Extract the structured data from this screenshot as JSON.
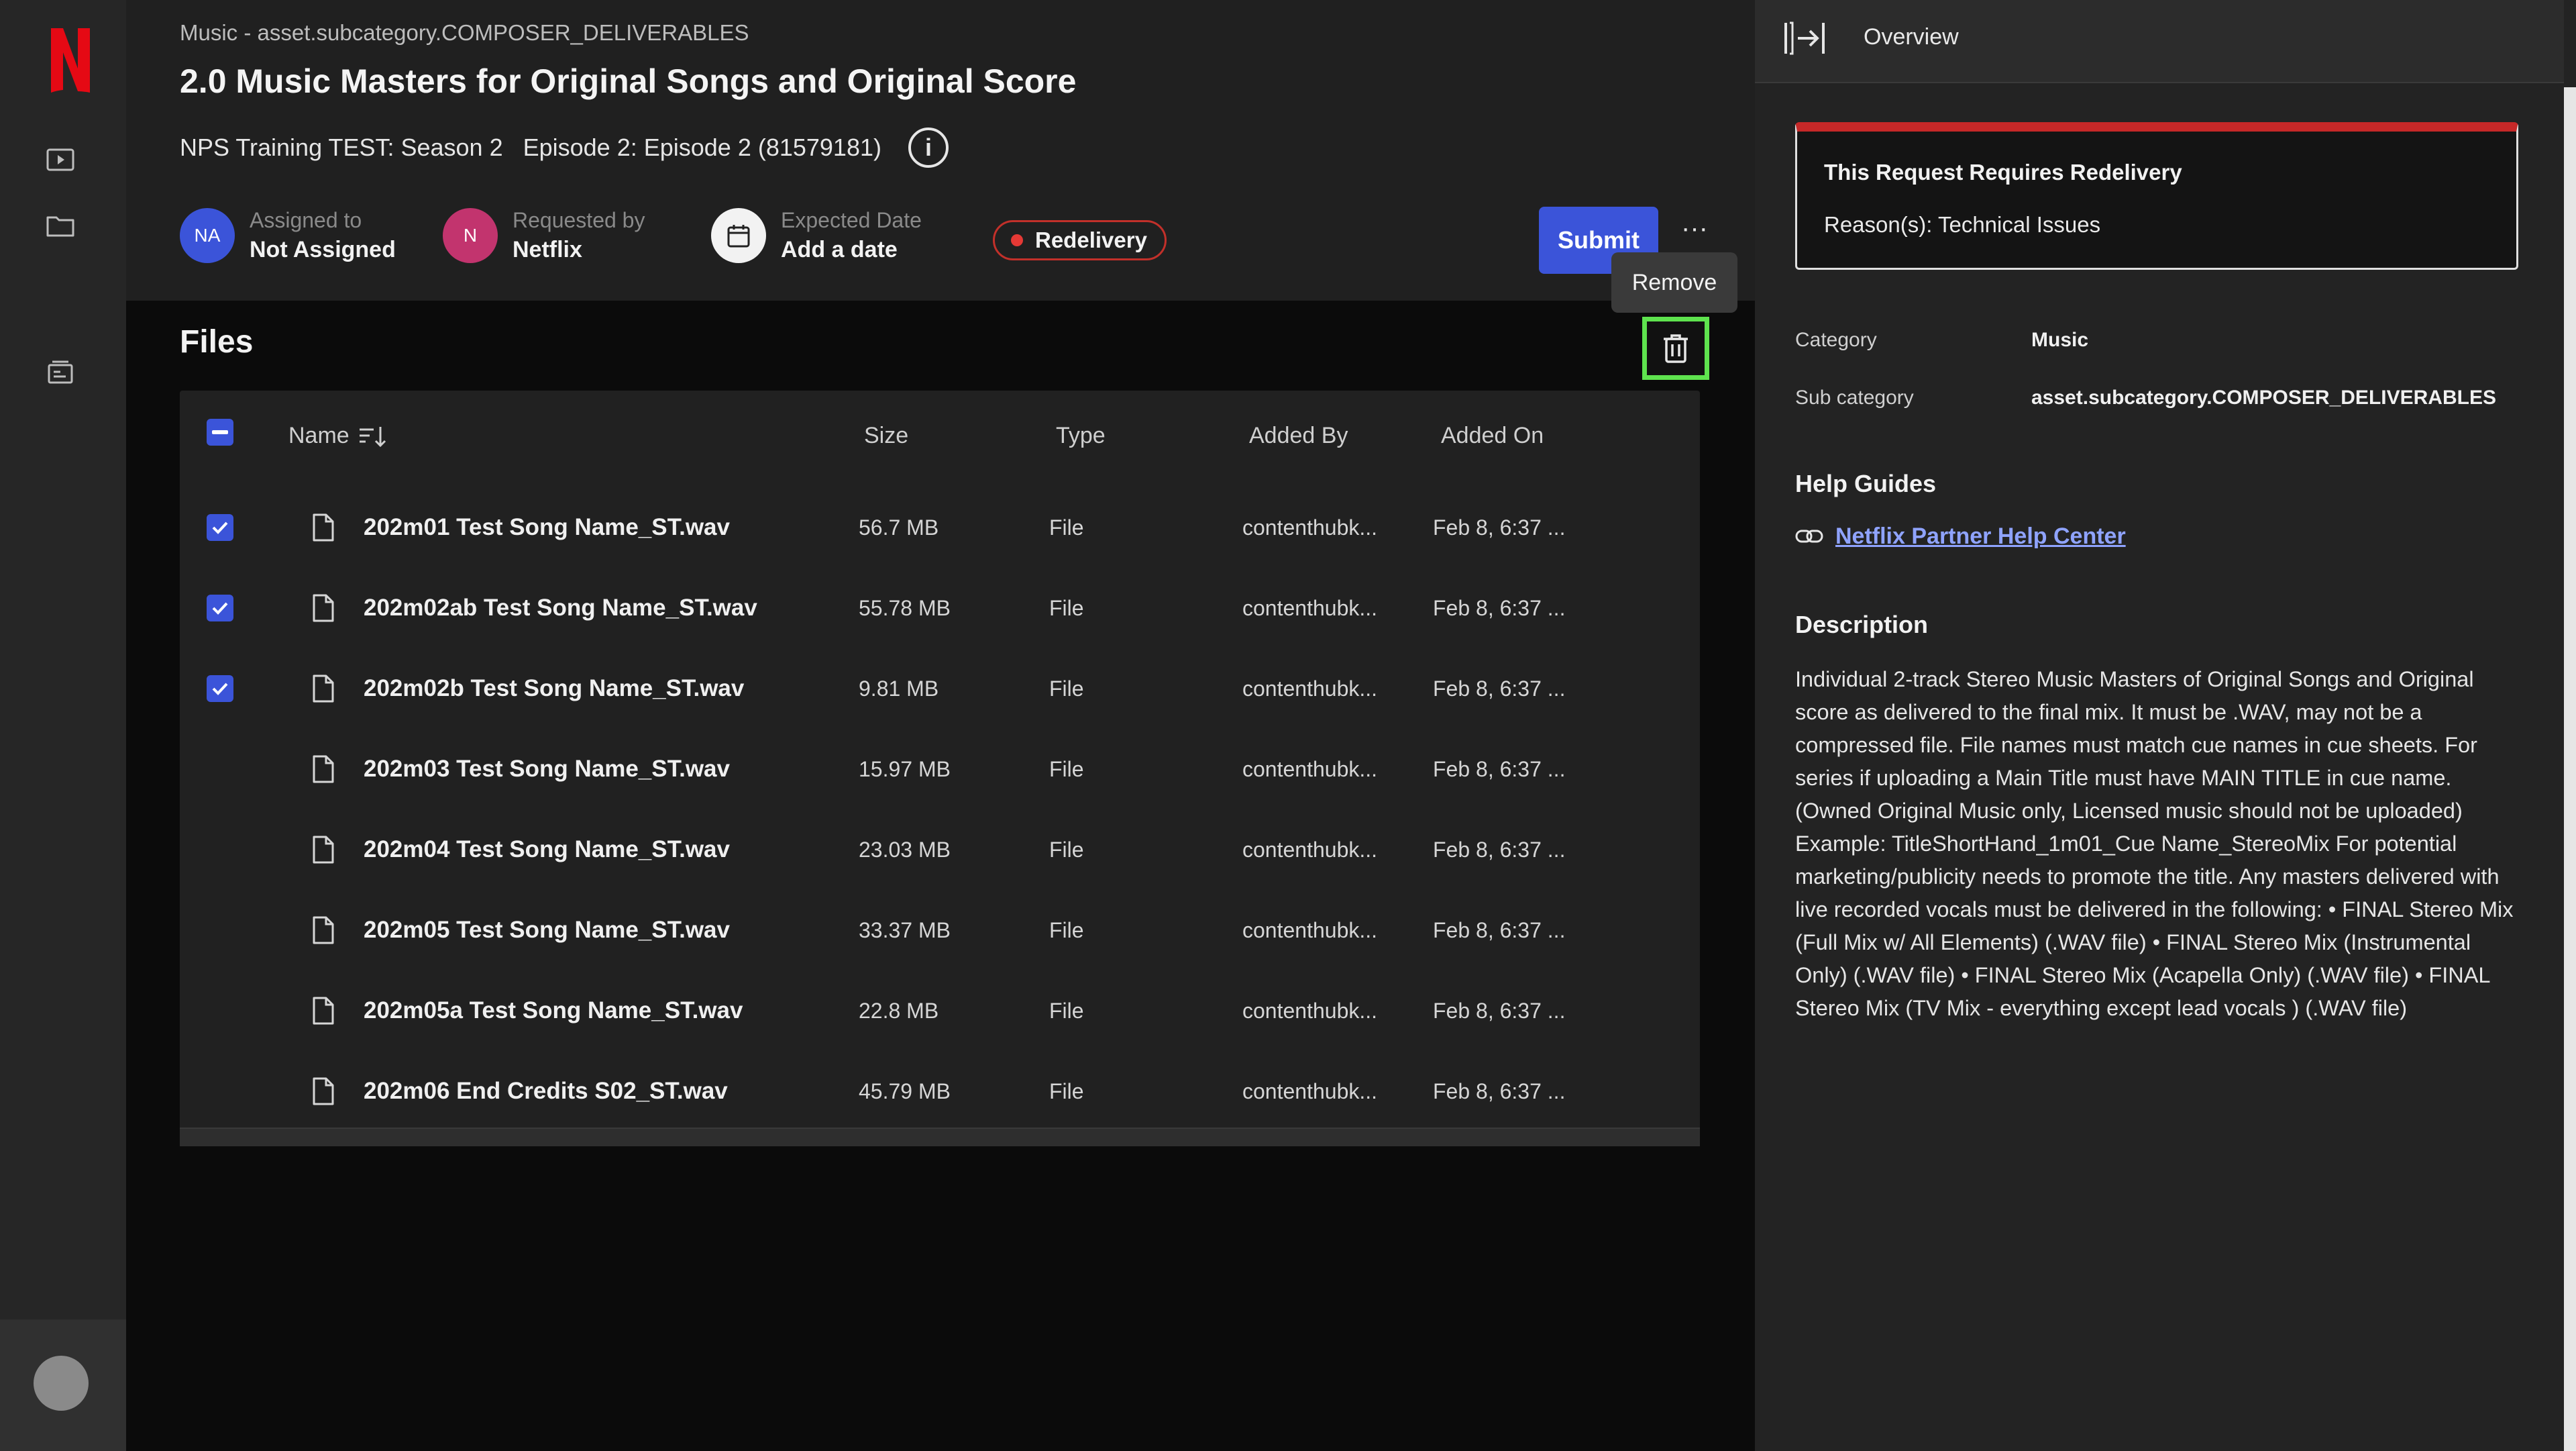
{
  "breadcrumb": "Music - asset.subcategory.COMPOSER_DELIVERABLES",
  "title": "2.0 Music Masters for Original Songs and Original Score",
  "subtitle": {
    "show": "NPS Training TEST: Season 2",
    "episode": "Episode 2: Episode 2 (81579181)"
  },
  "meta": {
    "assigned_initials": "NA",
    "assigned_label": "Assigned to",
    "assigned_value": "Not Assigned",
    "requested_initials": "N",
    "requested_label": "Requested by",
    "requested_value": "Netflix",
    "date_label": "Expected Date",
    "date_value": "Add a date"
  },
  "status_badge": "Redelivery",
  "submit_label": "Submit",
  "more_label": "···",
  "tooltip_remove": "Remove",
  "files_title": "Files",
  "table": {
    "headers": [
      "Name",
      "Size",
      "Type",
      "Added By",
      "Added On"
    ],
    "rows": [
      {
        "checked": true,
        "name": "202m01 Test Song Name_ST.wav",
        "size": "56.7 MB",
        "type": "File",
        "added_by": "contenthubk...",
        "added_on": "Feb 8, 6:37 ..."
      },
      {
        "checked": true,
        "name": "202m02ab Test Song Name_ST.wav",
        "size": "55.78 MB",
        "type": "File",
        "added_by": "contenthubk...",
        "added_on": "Feb 8, 6:37 ..."
      },
      {
        "checked": true,
        "name": "202m02b Test Song Name_ST.wav",
        "size": "9.81 MB",
        "type": "File",
        "added_by": "contenthubk...",
        "added_on": "Feb 8, 6:37 ..."
      },
      {
        "checked": false,
        "name": "202m03 Test Song Name_ST.wav",
        "size": "15.97 MB",
        "type": "File",
        "added_by": "contenthubk...",
        "added_on": "Feb 8, 6:37 ..."
      },
      {
        "checked": false,
        "name": "202m04 Test Song Name_ST.wav",
        "size": "23.03 MB",
        "type": "File",
        "added_by": "contenthubk...",
        "added_on": "Feb 8, 6:37 ..."
      },
      {
        "checked": false,
        "name": "202m05 Test Song Name_ST.wav",
        "size": "33.37 MB",
        "type": "File",
        "added_by": "contenthubk...",
        "added_on": "Feb 8, 6:37 ..."
      },
      {
        "checked": false,
        "name": "202m05a Test Song Name_ST.wav",
        "size": "22.8 MB",
        "type": "File",
        "added_by": "contenthubk...",
        "added_on": "Feb 8, 6:37 ..."
      },
      {
        "checked": false,
        "name": "202m06 End Credits S02_ST.wav",
        "size": "45.79 MB",
        "type": "File",
        "added_by": "contenthubk...",
        "added_on": "Feb 8, 6:37 ..."
      }
    ]
  },
  "panel": {
    "title": "Overview",
    "notice_heading": "This Request Requires Redelivery",
    "notice_reason": "Reason(s): Technical Issues",
    "category_label": "Category",
    "category_value": "Music",
    "subcategory_label": "Sub category",
    "subcategory_value": "asset.subcategory.COMPOSER_DELIVERABLES",
    "help_heading": "Help Guides",
    "help_link": "Netflix Partner Help Center",
    "description_heading": "Description",
    "description": "Individual 2-track Stereo Music Masters of Original Songs and Original score as delivered to the final mix. It must be .WAV, may not be a compressed file. File names must match cue names in cue sheets. For series if uploading a Main Title must have MAIN TITLE in cue name. (Owned Original Music only, Licensed music should not be uploaded) Example: TitleShortHand_1m01_Cue Name_StereoMix For potential marketing/publicity needs to promote the title. Any masters delivered with live recorded vocals must be delivered in the following: • FINAL Stereo Mix (Full Mix w/ All Elements) (.WAV file) • FINAL Stereo Mix (Instrumental Only) (.WAV file) • FINAL Stereo Mix (Acapella Only) (.WAV file) • FINAL Stereo Mix (TV Mix - everything except lead vocals ) (.WAV file)"
  },
  "colors": {
    "accent": "#3b54d9",
    "danger": "#c62828",
    "highlight": "#5ee34e",
    "link": "#8fa3ff"
  },
  "icons": [
    "netflix-logo-icon",
    "play-icon",
    "folder-icon",
    "inbox-icon",
    "info-icon",
    "calendar-icon",
    "sort-icon",
    "file-icon",
    "trash-icon",
    "collapse-panel-icon",
    "link-icon"
  ]
}
